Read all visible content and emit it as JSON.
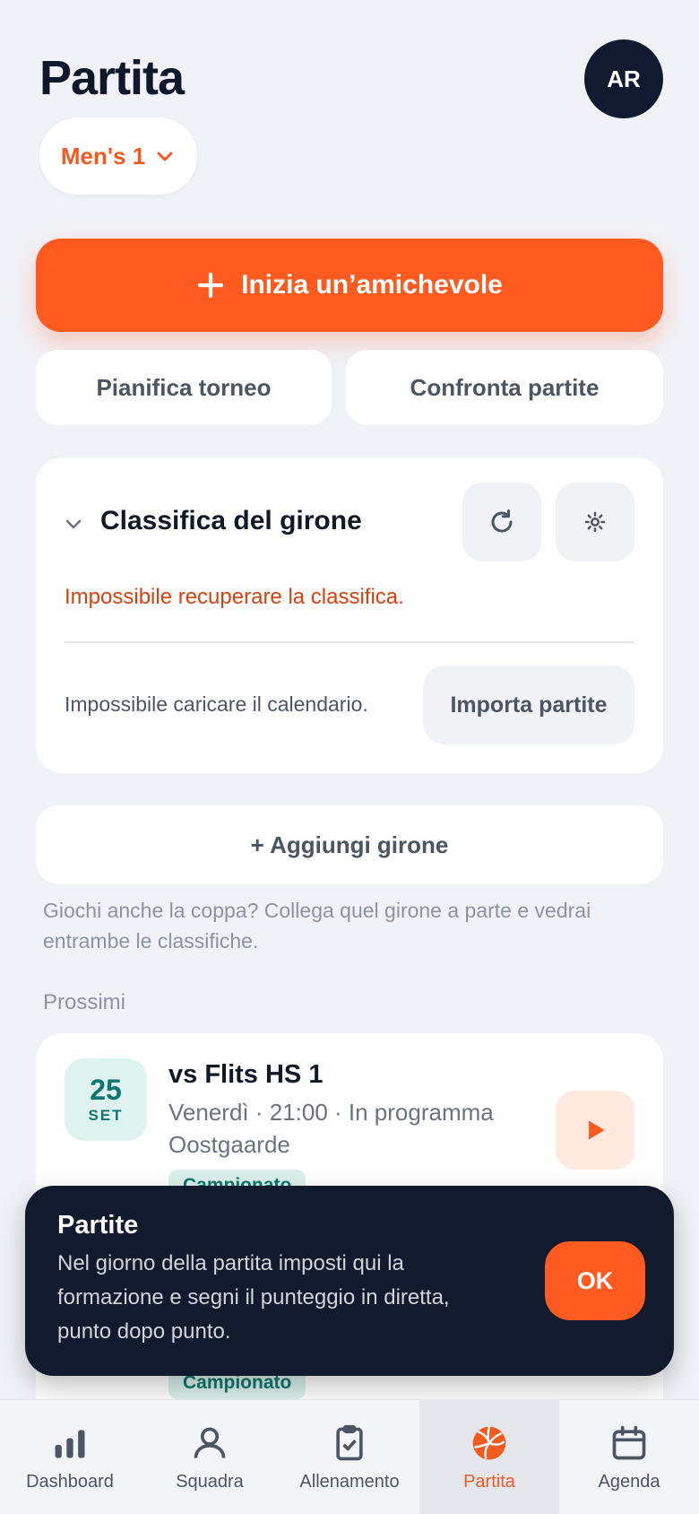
{
  "header": {
    "title": "Partita",
    "avatar_initials": "AR",
    "team_select": "Men's 1"
  },
  "actions": {
    "primary": "Inizia un’amichevole",
    "plan_tournament": "Pianifica torneo",
    "compare_matches": "Confronta partite"
  },
  "standings": {
    "title": "Classifica del girone",
    "error": "Impossibile recuperare la classifica.",
    "calendar_error": "Impossibile caricare il calendario.",
    "import_label": "Importa partite"
  },
  "add_group_label": "+ Aggiungi girone",
  "hint": "Giochi anche la coppa? Collega quel girone a parte e vedrai entrambe le classifiche.",
  "upcoming": {
    "label": "Prossimi",
    "match": {
      "day": "25",
      "month": "SET",
      "opponent": "vs Flits HS 1",
      "meta": "Venerdì · 21:00 · In programma",
      "location": "Oostgaarde",
      "tag": "Campionato"
    },
    "second_tag": "Campionato"
  },
  "toast": {
    "title": "Partite",
    "body": "Nel giorno della partita imposti qui la formazione e segni il punteggio in diretta, punto dopo punto.",
    "ok": "OK"
  },
  "nav": {
    "items": [
      {
        "label": "Dashboard",
        "icon": "bar-chart-icon"
      },
      {
        "label": "Squadra",
        "icon": "person-icon"
      },
      {
        "label": "Allenamento",
        "icon": "clipboard-check-icon"
      },
      {
        "label": "Partita",
        "icon": "volleyball-icon",
        "active": true
      },
      {
        "label": "Agenda",
        "icon": "calendar-icon"
      }
    ]
  },
  "colors": {
    "accent": "#ff5a1f",
    "dark": "#121a2e",
    "teal": "#0f766e",
    "background": "#f1f2f7"
  }
}
